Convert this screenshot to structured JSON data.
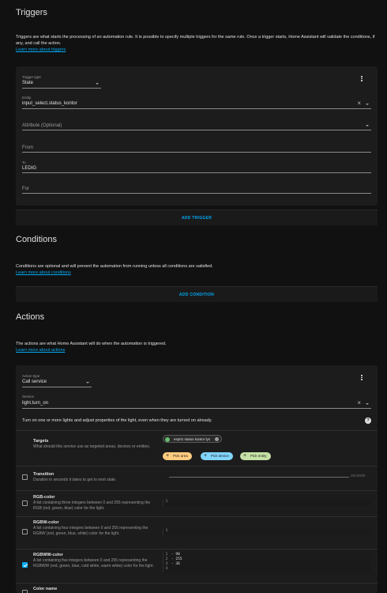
{
  "triggers": {
    "heading": "Triggers",
    "description": "Triggers are what starts the processing of an automation rule. It is possible to specify multiple triggers for the same rule. Once a trigger starts, Home Assistant will validate the conditions, if any, and call the action.",
    "learn_more": "Learn more about triggers",
    "trigger_type_label": "Trigger type",
    "trigger_type_value": "State",
    "entity_label": "Entity",
    "entity_value": "input_select.status_kontor",
    "attribute_placeholder": "Attribute (Optional)",
    "from_placeholder": "From",
    "to_label": "To",
    "to_value": "LEDIG",
    "for_placeholder": "For",
    "add_button": "ADD TRIGGER"
  },
  "conditions": {
    "heading": "Conditions",
    "description": "Conditions are optional and will prevent the automation from running unless all conditions are satisfied.",
    "learn_more": "Learn more about conditions",
    "add_button": "ADD CONDITION"
  },
  "actions": {
    "heading": "Actions",
    "description": "The actions are what Home Assistant will do when the automation is triggered.",
    "learn_more": "Learn more about actions",
    "action_type_label": "Action type",
    "action_type_value": "Call service",
    "service_label": "Service",
    "service_value": "light.turn_on",
    "service_description": "Turn on one or more lights and adjust properties of the light, even when they are turned on already.",
    "targets": {
      "title": "Targets",
      "description": "What should this service use as targeted areas, devices or entities.",
      "selected_chip": "esp01 status kontor lys",
      "pick_area": "Pick area",
      "pick_device": "Pick device",
      "pick_entity": "Pick entity"
    },
    "transition": {
      "title": "Transition",
      "description": "Duration in seconds it takes to get to next state.",
      "unit": "seconds"
    },
    "rgb": {
      "title": "RGB-color",
      "description": "A list containing three integers between 0 and 255 representing the RGB (red, green, blue) color for the light.",
      "line1": "1"
    },
    "rgbw": {
      "title": "RGBW-color",
      "description": "A list containing four integers between 0 and 255 representing the RGBW (red, green, blue, white) color for the light.",
      "line1": "1"
    },
    "rgbww": {
      "title": "RGBWW-color",
      "description": "A list containing five integers between 0 and 255 representing the RGBWW (red, green, blue, cold white, warm white) color for the light.",
      "lines": [
        "1",
        "2",
        "3",
        "4"
      ],
      "code": [
        "- 98",
        "- 255",
        "- 36",
        ""
      ]
    },
    "color_name": {
      "title": "Color name"
    }
  },
  "colors": {
    "accent": "#03a9f4",
    "chip_area": "#ffcc80",
    "chip_device": "#81d4fa",
    "chip_entity": "#c5e1a5",
    "chip_selected_icon": "#66bb6a"
  }
}
